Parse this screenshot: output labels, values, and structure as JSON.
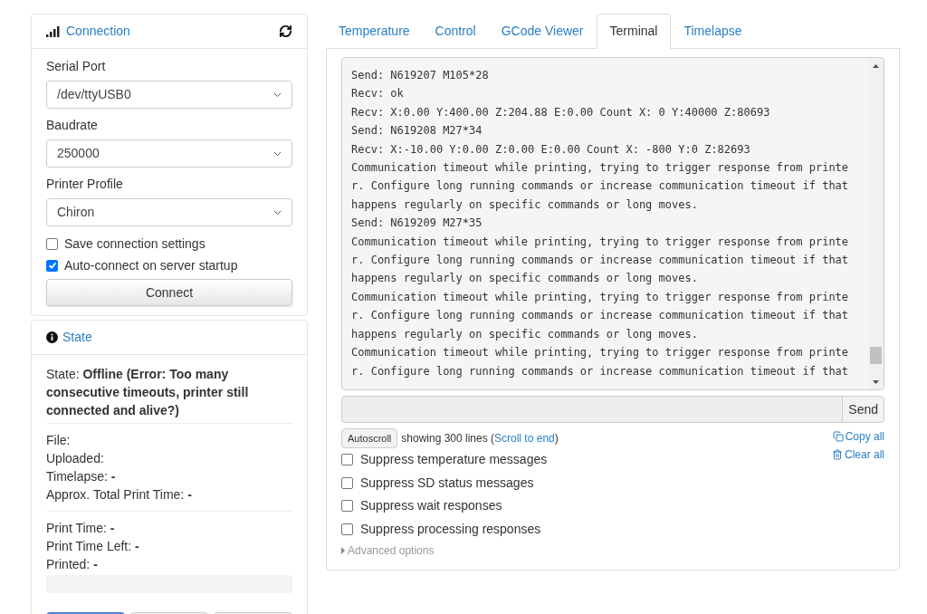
{
  "connection": {
    "title": "Connection",
    "fields": [
      {
        "label": "Serial Port",
        "value": "/dev/ttyUSB0"
      },
      {
        "label": "Baudrate",
        "value": "250000"
      },
      {
        "label": "Printer Profile",
        "value": "Chiron"
      }
    ],
    "options": [
      {
        "label": "Save connection settings",
        "checked": false
      },
      {
        "label": "Auto-connect on server startup",
        "checked": true
      }
    ],
    "button": "Connect"
  },
  "state": {
    "title": "State",
    "status_label": "State:",
    "status_value": "Offline (Error: Too many consecutive timeouts, printer still connected and alive?)",
    "groups": [
      [
        "File:",
        "Uploaded:",
        "Timelapse: **-**",
        "Approx. Total Print Time: **-**"
      ],
      [
        "Print Time: **-**",
        "Print Time Left: **-**",
        "Printed: **-**"
      ]
    ],
    "progress": {
      "level": 0
    },
    "buttons": [
      {
        "kind": "primary"
      },
      {
        "kind": "default"
      },
      {
        "kind": "default"
      }
    ]
  },
  "tabs": [
    {
      "label": "Temperature",
      "selected": false
    },
    {
      "label": "Control",
      "selected": false
    },
    {
      "label": "GCode Viewer",
      "selected": false
    },
    {
      "label": "Terminal",
      "selected": true
    },
    {
      "label": "Timelapse",
      "selected": false
    }
  ],
  "terminal": {
    "lines": [
      "Send: N619207 M105*28",
      "Recv: ok",
      "Recv: X:0.00 Y:400.00 Z:204.88 E:0.00 Count X: 0 Y:40000 Z:80693",
      "Send: N619208 M27*34",
      "Recv: X:-10.00 Y:0.00 Z:0.00 E:0.00 Count X: -800 Y:0 Z:82693",
      "Communication timeout while printing, trying to trigger response from printer. Configure long running commands or increase communication timeout if that happens regularly on specific commands or long moves.",
      "Send: N619209 M27*35",
      "Communication timeout while printing, trying to trigger response from printer. Configure long running commands or increase communication timeout if that happens regularly on specific commands or long moves.",
      "Communication timeout while printing, trying to trigger response from printer. Configure long running commands or increase communication timeout if that happens regularly on specific commands or long moves.",
      "Communication timeout while printing, trying to trigger response from printer. Configure long running commands or increase communication timeout if that"
    ],
    "send_button": "Send",
    "autoscroll": "Autoscroll",
    "showing": "showing 300 lines (",
    "scroll_link": "Scroll to end",
    "showing_end": ")",
    "copy_all": "Copy all",
    "clear_all": "Clear all",
    "filters": [
      {
        "label": "Suppress temperature messages",
        "checked": false
      },
      {
        "label": "Suppress SD status messages",
        "checked": false
      },
      {
        "label": "Suppress wait responses",
        "checked": false
      },
      {
        "label": "Suppress processing responses",
        "checked": false
      }
    ],
    "advanced": "Advanced options"
  }
}
